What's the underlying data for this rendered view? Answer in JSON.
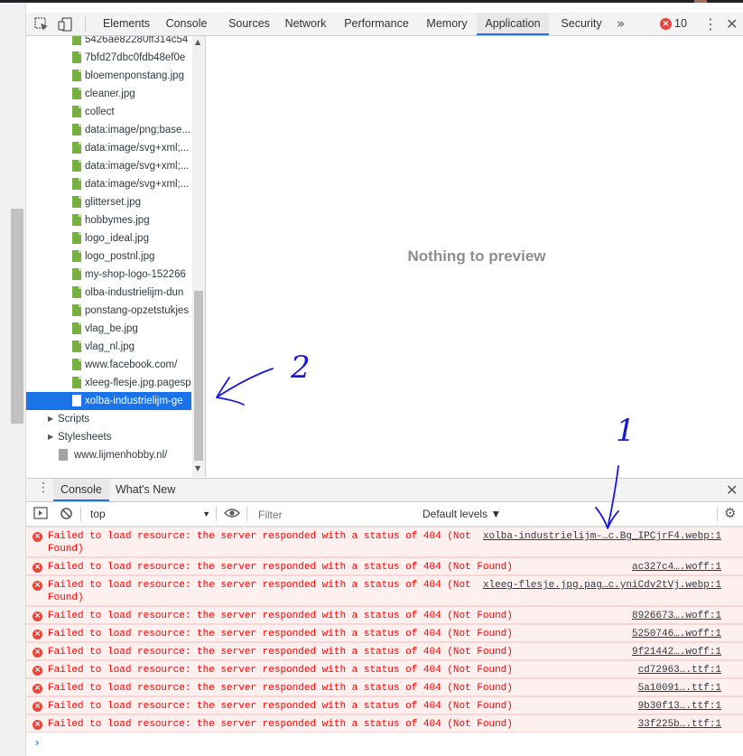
{
  "devtools": {
    "tabs": [
      "Elements",
      "Console",
      "Sources",
      "Network",
      "Performance",
      "Memory",
      "Application",
      "Security"
    ],
    "active_tab": "Application",
    "more_tabs": "»",
    "error_count": "10"
  },
  "tree": {
    "items": [
      "5426ae82280ff314c54",
      "7bfd27dbc0fdb48ef0e",
      "bloemenponstang.jpg",
      "cleaner.jpg",
      "collect",
      "data:image/png;base...",
      "data:image/svg+xml;...",
      "data:image/svg+xml;...",
      "data:image/svg+xml;...",
      "glitterset.jpg",
      "hobbymes.jpg",
      "logo_ideal.jpg",
      "logo_postnl.jpg",
      "my-shop-logo-152266",
      "olba-industrielijm-dun",
      "ponstang-opzetstukjes",
      "vlag_be.jpg",
      "vlag_nl.jpg",
      "www.facebook.com/",
      "xleeg-flesje.jpg.pagesp",
      "xolba-industrielijm-ge"
    ],
    "selected": "xolba-industrielijm-ge",
    "folders": [
      "Scripts",
      "Stylesheets"
    ],
    "frame": "www.lijmenhobby.nl/"
  },
  "preview": {
    "message": "Nothing to preview"
  },
  "drawer": {
    "tabs": [
      "Console",
      "What's New"
    ],
    "active_tab": "Console"
  },
  "console_toolbar": {
    "context": "top",
    "filter_placeholder": "Filter",
    "levels": "Default levels ▼"
  },
  "console": {
    "messages": [
      {
        "line1": "Failed to load resource: the server responded with a status of 404 (Not",
        "line2": "Found)",
        "source": "xolba-industrielijm-…c.Bg_IPCjrF4.webp:1"
      },
      {
        "line1": "Failed to load resource: the server responded with a status of 404 (Not Found)",
        "line2": "",
        "source": "ac327c4….woff:1"
      },
      {
        "line1": "Failed to load resource: the server responded with a status of 404 (Not",
        "line2": "Found)",
        "source": "xleeg-flesje.jpg.pag…c.yniCdv2tVj.webp:1"
      },
      {
        "line1": "Failed to load resource: the server responded with a status of 404 (Not Found)",
        "line2": "",
        "source": "8926673….woff:1"
      },
      {
        "line1": "Failed to load resource: the server responded with a status of 404 (Not Found)",
        "line2": "",
        "source": "5250746….woff:1"
      },
      {
        "line1": "Failed to load resource: the server responded with a status of 404 (Not Found)",
        "line2": "",
        "source": "9f21442….woff:1"
      },
      {
        "line1": "Failed to load resource: the server responded with a status of 404 (Not Found)",
        "line2": "",
        "source": "cd72963….ttf:1"
      },
      {
        "line1": "Failed to load resource: the server responded with a status of 404 (Not Found)",
        "line2": "",
        "source": "5a10091….ttf:1"
      },
      {
        "line1": "Failed to load resource: the server responded with a status of 404 (Not Found)",
        "line2": "",
        "source": "9b30f13….ttf:1"
      },
      {
        "line1": "Failed to load resource: the server responded with a status of 404 (Not Found)",
        "line2": "",
        "source": "33f225b….ttf:1"
      }
    ],
    "prompt": "›"
  },
  "annotations": {
    "label_1": "1",
    "label_2": "2",
    "color": "#1a1ad6"
  }
}
